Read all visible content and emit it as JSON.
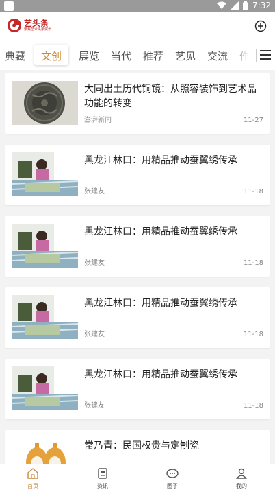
{
  "status_bar": {
    "time": "7:32"
  },
  "app": {
    "logo_name": "艺头条",
    "logo_tagline": "聚焦艺术头条资讯"
  },
  "tabs": [
    {
      "label": "典藏"
    },
    {
      "label": "文创",
      "active": true
    },
    {
      "label": "展览"
    },
    {
      "label": "当代"
    },
    {
      "label": "推荐"
    },
    {
      "label": "艺见"
    },
    {
      "label": "交流"
    },
    {
      "label": "作"
    }
  ],
  "news": [
    {
      "title": "大同出土历代铜镜：从照容装饰到艺术品功能的转变",
      "source": "澎湃新闻",
      "date": "11-27",
      "thumb": "bronze-mirror"
    },
    {
      "title": "黑龙江林口：用精品推动蚕翼绣传承",
      "source": "张建友",
      "date": "11-18",
      "thumb": "embroidery"
    },
    {
      "title": "黑龙江林口：用精品推动蚕翼绣传承",
      "source": "张建友",
      "date": "11-18",
      "thumb": "embroidery"
    },
    {
      "title": "黑龙江林口：用精品推动蚕翼绣传承",
      "source": "张建友",
      "date": "11-18",
      "thumb": "embroidery"
    },
    {
      "title": "黑龙江林口：用精品推动蚕翼绣传承",
      "source": "张建友",
      "date": "11-18",
      "thumb": "embroidery"
    },
    {
      "title": "常乃青：民国权贵与定制瓷",
      "source": "",
      "date": "",
      "thumb": "porcelain"
    }
  ],
  "bottom_nav": [
    {
      "label": "首页",
      "icon": "home-icon",
      "active": true
    },
    {
      "label": "资讯",
      "icon": "news-icon"
    },
    {
      "label": "圈子",
      "icon": "circle-icon"
    },
    {
      "label": "我的",
      "icon": "profile-icon"
    }
  ],
  "colors": {
    "accent": "#c9893a",
    "brand_red": "#c62828",
    "status_bar": "#9a9a9a"
  }
}
